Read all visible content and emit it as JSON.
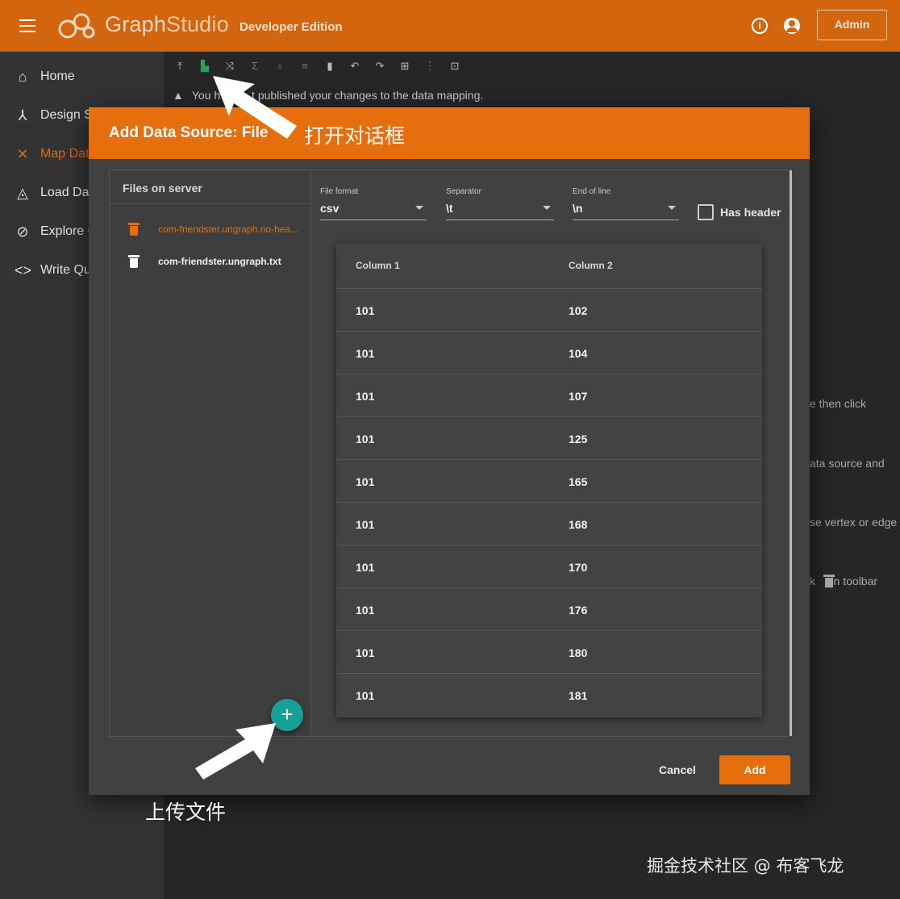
{
  "app": {
    "brand_graph": "Graph",
    "brand_studio": "Studio",
    "edition": "Developer Edition",
    "admin_label": "Admin",
    "info_glyph": "i",
    "accent_color": "#d4650f"
  },
  "sidenav": {
    "items": [
      {
        "label": "Home",
        "icon": "home-icon",
        "glyph": "⌂"
      },
      {
        "label": "Design S",
        "icon": "schema-icon",
        "glyph": "⅄"
      },
      {
        "label": "Map Data",
        "icon": "shuffle-icon",
        "glyph": "✕",
        "active": true
      },
      {
        "label": "Load Dat",
        "icon": "droplet-icon",
        "glyph": "◬"
      },
      {
        "label": "Explore G",
        "icon": "compass-icon",
        "glyph": "⊘"
      },
      {
        "label": "Write Qu",
        "icon": "code-icon",
        "glyph": "<>"
      }
    ]
  },
  "toolbar": {
    "buttons": [
      {
        "name": "publish-icon",
        "glyph": "⤒"
      },
      {
        "name": "add-data-file-icon",
        "glyph": "▙",
        "color": "green"
      },
      {
        "name": "map-icon",
        "glyph": "⤨"
      },
      {
        "name": "sum-icon",
        "glyph": "Σ",
        "dim": true
      },
      {
        "name": "bulb-icon",
        "glyph": "♁",
        "dim": true
      },
      {
        "name": "filter-icon",
        "glyph": "≡",
        "dim": true
      },
      {
        "name": "delete-icon",
        "glyph": "▮"
      },
      {
        "name": "undo-icon",
        "glyph": "↶"
      },
      {
        "name": "redo-icon",
        "glyph": "↷"
      },
      {
        "name": "select-icon",
        "glyph": "⊞"
      },
      {
        "name": "split-icon",
        "glyph": "⋮",
        "dim": true
      },
      {
        "name": "grid-icon",
        "glyph": "⊡"
      }
    ]
  },
  "warning": {
    "text": "You h          t published your changes to the data mapping."
  },
  "hints": [
    {
      "text": "e then click"
    },
    {
      "text": "ata source and"
    },
    {
      "text": "se vertex or edge"
    },
    {
      "text": "k     in toolbar"
    }
  ],
  "dialog": {
    "title": "Add Data Source: File",
    "files_title": "Files on server",
    "files": [
      {
        "name": "com-friendster.ungraph.no-hea...",
        "selected": true
      },
      {
        "name": "com-friendster.ungraph.txt",
        "selected": false
      }
    ],
    "upload_glyph": "+",
    "file_format": {
      "label": "File format",
      "value": "csv"
    },
    "separator": {
      "label": "Separator",
      "value": "\\t"
    },
    "end_of_line": {
      "label": "End of line",
      "value": "\\n"
    },
    "has_header_label": "Has header",
    "has_header_checked": false,
    "columns": [
      "Column 1",
      "Column 2"
    ],
    "rows": [
      [
        "101",
        "102"
      ],
      [
        "101",
        "104"
      ],
      [
        "101",
        "107"
      ],
      [
        "101",
        "125"
      ],
      [
        "101",
        "165"
      ],
      [
        "101",
        "168"
      ],
      [
        "101",
        "170"
      ],
      [
        "101",
        "176"
      ],
      [
        "101",
        "180"
      ],
      [
        "101",
        "181"
      ]
    ],
    "cancel_label": "Cancel",
    "add_label": "Add"
  },
  "annotations": {
    "open_dialog": "打开对话框",
    "upload_file": "上传文件"
  },
  "watermark": "掘金技术社区 @ 布客飞龙"
}
